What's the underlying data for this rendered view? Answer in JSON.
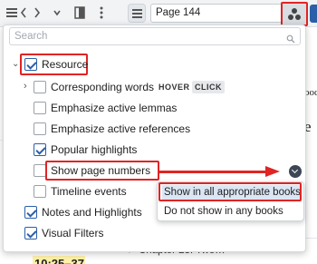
{
  "toolbar": {
    "page_value": "Page 144",
    "icons": [
      "hamburger-icon",
      "chevron-left-icon",
      "chevron-right-icon",
      "chevron-down-icon",
      "columns-icon",
      "more-vertical-icon",
      "search-icon",
      "multi-dot-icon"
    ]
  },
  "dropdown": {
    "search_placeholder": "Search",
    "items": [
      {
        "label": "Resource",
        "checked": true
      },
      {
        "label": "Corresponding words",
        "checked": false
      },
      {
        "label": "Emphasize active lemmas",
        "checked": false
      },
      {
        "label": "Emphasize active references",
        "checked": false
      },
      {
        "label": "Popular highlights",
        "checked": true
      },
      {
        "label": "Show page numbers",
        "checked": false
      },
      {
        "label": "Timeline events",
        "checked": false
      },
      {
        "label": "Notes and Highlights",
        "checked": true
      },
      {
        "label": "Visual Filters",
        "checked": true
      }
    ],
    "hover_tag": "HOVER",
    "click_tag": "CLICK"
  },
  "submenu": {
    "options": [
      "Show in all appropriate books",
      "Do not show in any books"
    ],
    "selected_index": 0
  },
  "background": {
    "reader_fragment_1": "ood",
    "reader_fragment_2": "e",
    "chapter_label": "Chapter 23: Two…",
    "time_label": "10:25–37"
  },
  "colors": {
    "annotation_red": "#e02424",
    "check_blue": "#2b5fa8",
    "selected_bg": "#dbe6f4",
    "hover_tag_bg": "#e6e8eb"
  }
}
